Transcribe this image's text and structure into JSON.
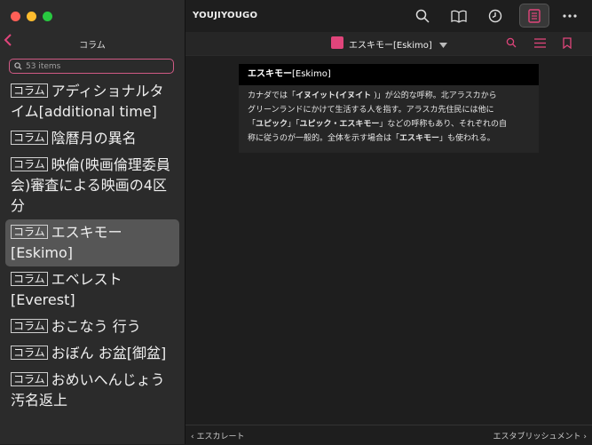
{
  "sidebar": {
    "title": "コラム",
    "search_placeholder": "53 items",
    "items": [
      {
        "tag": "コラム",
        "text": "アディショナルタイム[additional time]"
      },
      {
        "tag": "コラム",
        "text": "陰暦月の異名"
      },
      {
        "tag": "コラム",
        "text": "映倫(映画倫理委員会)審査による映画の4区分"
      },
      {
        "tag": "コラム",
        "text": "エスキモー[Eskimo]",
        "selected": true
      },
      {
        "tag": "コラム",
        "text": "エベレスト[Everest]"
      },
      {
        "tag": "コラム",
        "text": "おこなう 行う"
      },
      {
        "tag": "コラム",
        "text": "おぼん お盆[御盆]"
      },
      {
        "tag": "コラム",
        "text": "おめいへんじょう 汚名返上"
      }
    ]
  },
  "header": {
    "app_title": "YOUJIYOUGO",
    "icons": [
      "search-icon",
      "book-icon",
      "history-icon",
      "document-icon",
      "more-icon"
    ],
    "entry_title": "エスキモー[Eskimo]"
  },
  "article": {
    "head_bold": "エスキモー",
    "head_rest": "[Eskimo]",
    "body_lines": [
      [
        "カナダでは「",
        "イヌイット(イヌイト ",
        ")」が公的な呼称。北アラスカから"
      ],
      [
        "グリーンランドにかけて生活する人を指す。アラスカ先住民には他に"
      ],
      [
        "「",
        "ユピック",
        "」「",
        "ユピック・エスキモー",
        "」などの呼称もあり、それぞれの自"
      ],
      [
        "称に従うのが一般的。全体を示す場合は「",
        "エスキモー",
        "」も使われる。"
      ]
    ]
  },
  "footer": {
    "prev": "エスカレート",
    "next": "エスタブリッシュメント"
  },
  "colors": {
    "accent": "#e0457b"
  }
}
